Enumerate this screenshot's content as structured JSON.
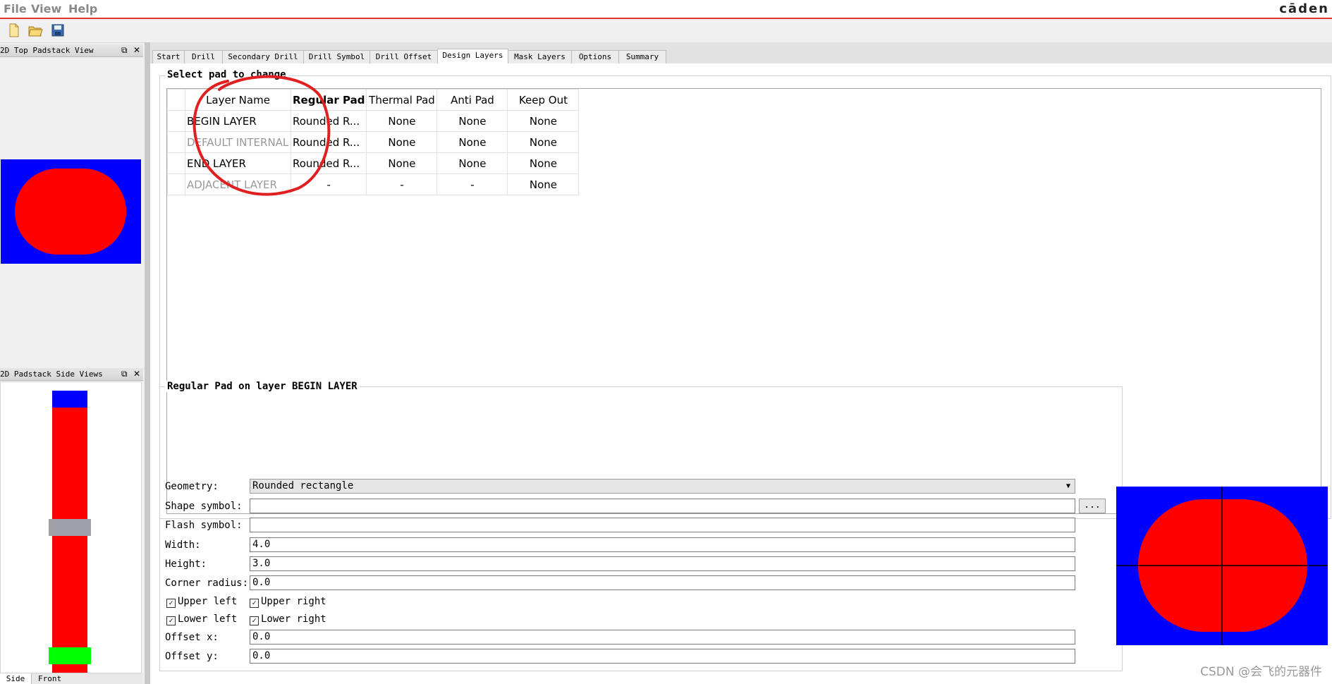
{
  "menu": {
    "file": "File",
    "view": "View",
    "help": "Help",
    "brand": "cāden"
  },
  "panels": {
    "top_view_title": "2D Top Padstack View",
    "side_view_title": "2D Padstack Side Views",
    "side_tabs": [
      "Side",
      "Front"
    ]
  },
  "tabs": [
    "Start",
    "Drill",
    "Secondary Drill",
    "Drill Symbol",
    "Drill Offset",
    "Design Layers",
    "Mask Layers",
    "Options",
    "Summary"
  ],
  "active_tab": "Design Layers",
  "pad_table": {
    "section_title": "Select pad to change",
    "columns": [
      "Layer Name",
      "Regular Pad",
      "Thermal Pad",
      "Anti Pad",
      "Keep Out"
    ],
    "rows": [
      [
        "BEGIN LAYER",
        "Rounded R...",
        "None",
        "None",
        "None"
      ],
      [
        "DEFAULT INTERNAL",
        "Rounded R...",
        "None",
        "None",
        "None"
      ],
      [
        "END LAYER",
        "Rounded R...",
        "None",
        "None",
        "None"
      ],
      [
        "ADJACENT LAYER",
        "-",
        "-",
        "-",
        "None"
      ]
    ]
  },
  "pad_editor": {
    "title": "Regular Pad on layer BEGIN LAYER",
    "geometry_label": "Geometry:",
    "geometry_value": "Rounded rectangle",
    "shape_symbol_label": "Shape symbol:",
    "shape_symbol_value": "",
    "browse_label": "...",
    "flash_symbol_label": "Flash symbol:",
    "flash_symbol_value": "",
    "width_label": "Width:",
    "width_value": "4.0",
    "height_label": "Height:",
    "height_value": "3.0",
    "corner_radius_label": "Corner radius:",
    "corner_radius_value": "0.0",
    "upper_left": "Upper left",
    "upper_right": "Upper right",
    "lower_left": "Lower left",
    "lower_right": "Lower right",
    "offset_x_label": "Offset x:",
    "offset_x_value": "0.0",
    "offset_y_label": "Offset y:",
    "offset_y_value": "0.0"
  },
  "watermark": "CSDN @会飞的元器件",
  "colors": {
    "pad": "#ff0000",
    "background": "#0000ff",
    "mask": "#00ff00",
    "drill": "#a0a0a8",
    "annotation": "#e02020"
  }
}
